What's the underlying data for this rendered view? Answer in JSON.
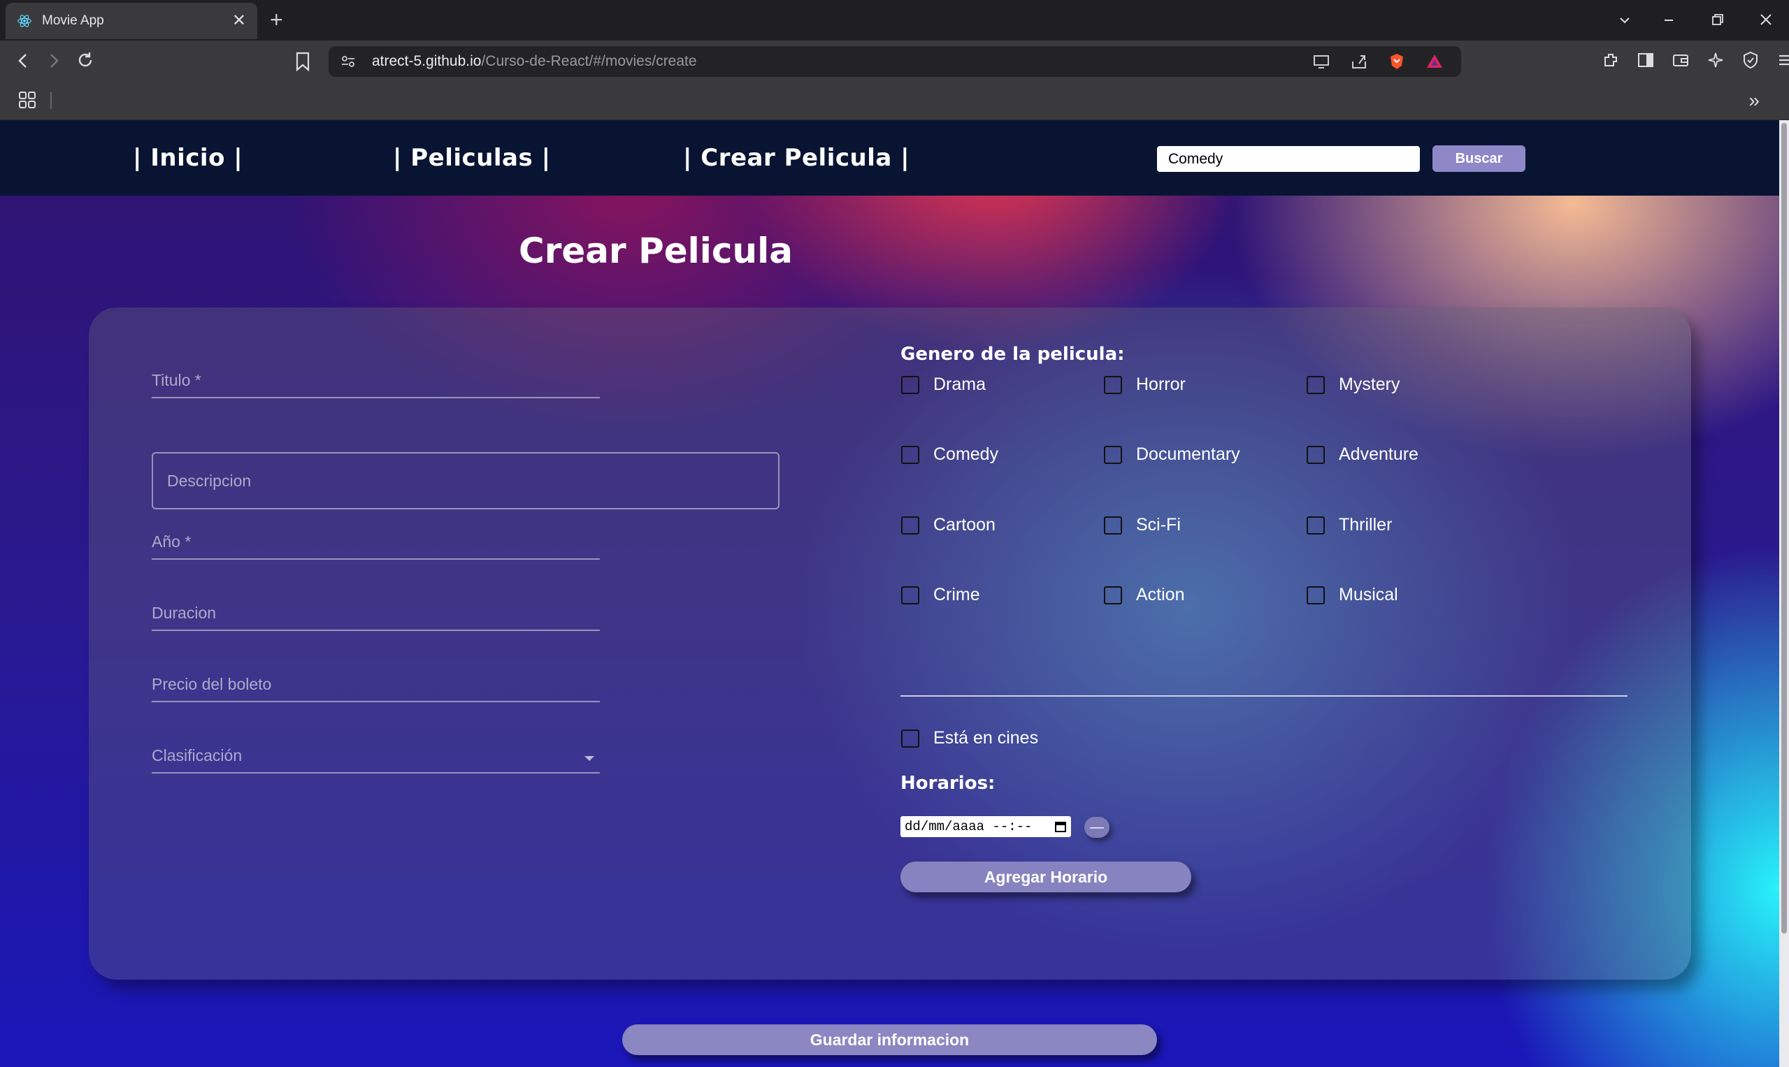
{
  "browser": {
    "tab_title": "Movie App",
    "tab_close": "✕",
    "new_tab": "+",
    "url_host": "atrect-5.github.io",
    "url_path": "/Curso-de-React/#/movies/create",
    "bookmarks_more": "»"
  },
  "nav": {
    "inicio": "| Inicio |",
    "peliculas": "| Peliculas |",
    "crear": "| Crear Pelicula |",
    "search_value": "Comedy",
    "search_button": "Buscar"
  },
  "page": {
    "title": "Crear Pelicula"
  },
  "form": {
    "titulo_label": "Titulo *",
    "descripcion_label": "Descripcion",
    "anio_label": "Año *",
    "duracion_label": "Duracion",
    "precio_label": "Precio del boleto",
    "clasificacion_label": "Clasificación",
    "genre_heading": "Genero de la pelicula:",
    "genres": [
      "Drama",
      "Horror",
      "Mystery",
      "Comedy",
      "Documentary",
      "Adventure",
      "Cartoon",
      "Sci-Fi",
      "Thriller",
      "Crime",
      "Action",
      "Musical"
    ],
    "en_cines_label": "Está en cines",
    "horarios_heading": "Horarios:",
    "datetime_placeholder": "dd/mm/aaaa --:--",
    "remove_symbol": "—",
    "add_schedule_button": "Agregar Horario",
    "save_button": "Guardar informacion"
  },
  "colors": {
    "navbar_bg": "#091433",
    "button_purple": "#8e88c9"
  }
}
